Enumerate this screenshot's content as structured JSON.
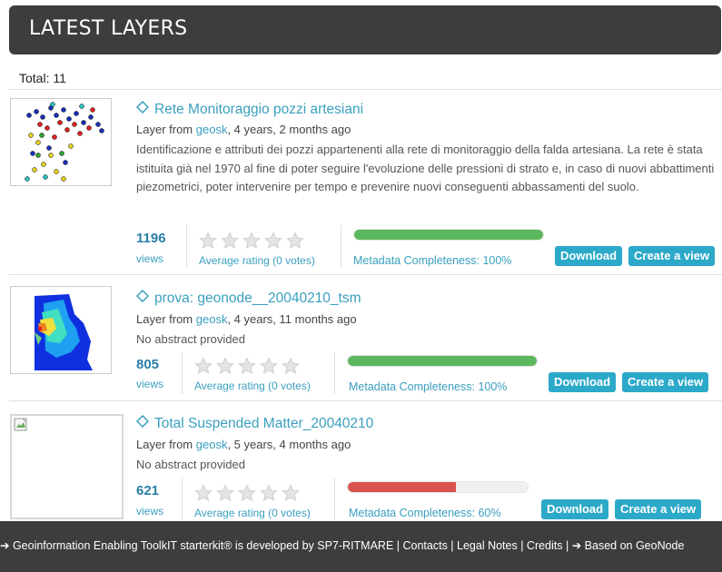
{
  "header": {
    "title": "LATEST LAYERS"
  },
  "total_label": "Total: 11",
  "layers": [
    {
      "title": "Rete Monitoraggio pozzi artesiani",
      "meta_prefix": "Layer from ",
      "owner": "geosk",
      "meta_suffix": ", 4 years, 2 months ago",
      "abstract": "Identificazione e attributi dei pozzi appartenenti alla rete di monitoraggio della falda artesiana. La rete è stata istituita già nel 1970 al fine di poter seguire l'evoluzione delle pressioni di strato e, in caso di nuovi abbattimenti piezometrici, poter intervenire per tempo e prevenire nuovi conseguenti abbassamenti del suolo.",
      "views": "1196",
      "views_label": "views",
      "rating_label": "Average rating (0 votes)",
      "completeness_label": "Metadata Completeness: 100%",
      "completeness": 1.0,
      "bar_color": "#5cb85c",
      "download_label": "Download",
      "create_view_label": "Create a view"
    },
    {
      "title": "prova: geonode__20040210_tsm",
      "meta_prefix": "Layer from ",
      "owner": "geosk",
      "meta_suffix": ", 4 years, 11 months ago",
      "abstract": "No abstract provided",
      "views": "805",
      "views_label": "views",
      "rating_label": "Average rating (0 votes)",
      "completeness_label": "Metadata Completeness: 100%",
      "completeness": 1.0,
      "bar_color": "#5cb85c",
      "download_label": "Download",
      "create_view_label": "Create a view"
    },
    {
      "title": "Total Suspended Matter_20040210",
      "meta_prefix": "Layer from ",
      "owner": "geosk",
      "meta_suffix": ", 5 years, 4 months ago",
      "abstract": "No abstract provided",
      "views": "621",
      "views_label": "views",
      "rating_label": "Average rating (0 votes)",
      "completeness_label": "Metadata Completeness: 60%",
      "completeness": 0.6,
      "bar_color": "#d9534f",
      "download_label": "Download",
      "create_view_label": "Create a view"
    }
  ],
  "footer": {
    "text": "➔ Geoinformation Enabling ToolkIT starterkit® is developed by SP7-RITMARE | Contacts | Legal Notes | Credits | ➔ Based on GeoNode"
  },
  "colors": {
    "accent": "#3a9fbf",
    "button": "#2ca9c9",
    "header_bg": "#3d3d3d"
  },
  "icons": [
    "diamond-icon",
    "star-icon",
    "broken-image-icon"
  ]
}
